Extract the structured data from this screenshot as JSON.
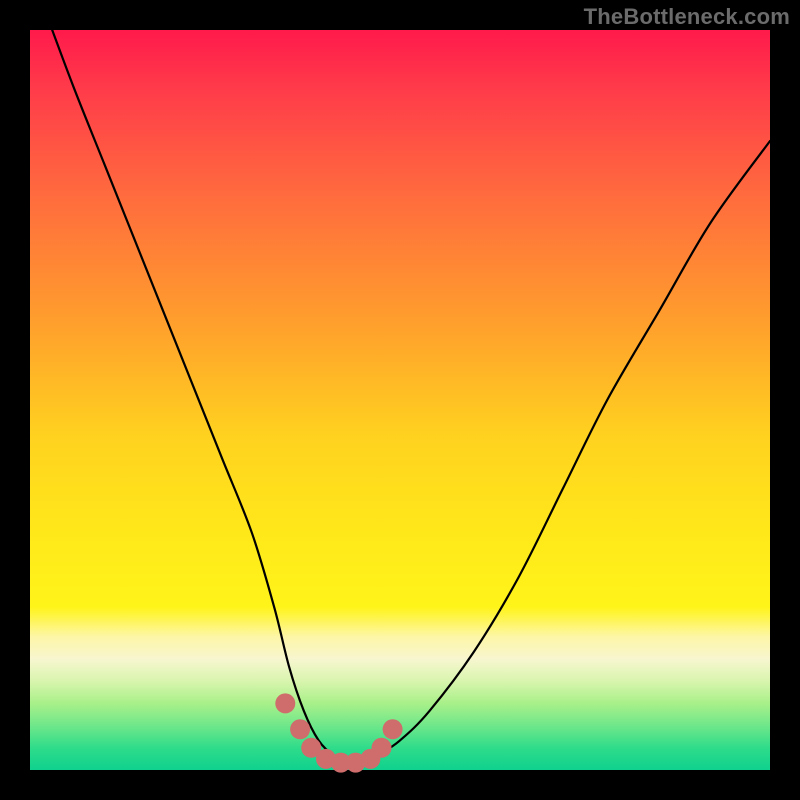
{
  "watermark": "TheBottleneck.com",
  "chart_data": {
    "type": "line",
    "title": "",
    "xlabel": "",
    "ylabel": "",
    "xlim": [
      0,
      100
    ],
    "ylim": [
      0,
      100
    ],
    "grid": false,
    "series": [
      {
        "name": "bottleneck-curve",
        "x": [
          3,
          6,
          10,
          14,
          18,
          22,
          26,
          30,
          33,
          35,
          37,
          39,
          41,
          43,
          45,
          47,
          50,
          54,
          60,
          66,
          72,
          78,
          85,
          92,
          100
        ],
        "y": [
          100,
          92,
          82,
          72,
          62,
          52,
          42,
          32,
          22,
          14,
          8,
          4,
          2,
          1,
          1,
          2,
          4,
          8,
          16,
          26,
          38,
          50,
          62,
          74,
          85
        ]
      }
    ],
    "markers": {
      "name": "bottom-dots",
      "color": "#cf6c6c",
      "x": [
        34.5,
        36.5,
        38.0,
        40.0,
        42.0,
        44.0,
        46.0,
        47.5,
        49.0
      ],
      "y": [
        9.0,
        5.5,
        3.0,
        1.5,
        1.0,
        1.0,
        1.5,
        3.0,
        5.5
      ]
    },
    "background_gradient": {
      "top": "#ff1a4b",
      "mid": "#ffe81a",
      "bottom": "#0fd18e"
    }
  }
}
